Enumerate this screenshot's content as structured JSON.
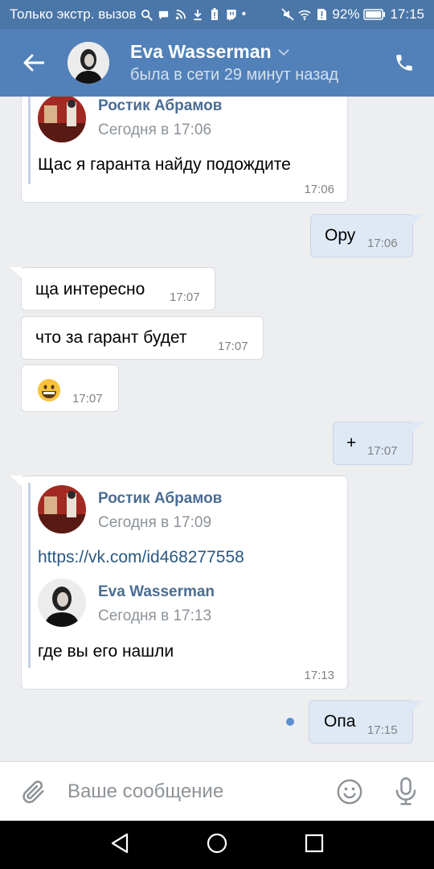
{
  "statusbar": {
    "carrier": "Только экстр. вызов",
    "battery": "92%",
    "time": "17:15"
  },
  "header": {
    "name": "Eva Wasserman",
    "status": "была в сети 29 минут назад"
  },
  "messages": [
    {
      "forward_name": "Ростик Абрамов",
      "forward_date": "Сегодня в 17:06",
      "text": "Щас я гаранта найду подождите",
      "time": "17:06"
    },
    {
      "text": "Ору",
      "time": "17:06"
    },
    {
      "text": "ща интересно",
      "time": "17:07"
    },
    {
      "text": "что за гарант будет",
      "time": "17:07"
    },
    {
      "emoji": "😄",
      "time": "17:07"
    },
    {
      "text": "+",
      "time": "17:07"
    },
    {
      "forward_name": "Ростик Абрамов",
      "forward_date": "Сегодня в 17:09",
      "link": "https://vk.com/id468277558",
      "nested_name": "Eva Wasserman",
      "nested_date": "Сегодня в 17:13",
      "text": "где вы его нашли",
      "time": "17:13"
    },
    {
      "text": "Опа",
      "time": "17:15"
    }
  ],
  "composer": {
    "placeholder": "Ваше сообщение"
  },
  "colors": {
    "header": "#5181b8",
    "statusbar": "#4a76a8",
    "background": "#edeef0",
    "outgoing_bubble": "#dfe9f5",
    "link": "#2a5885"
  },
  "icons": {
    "back": "arrow-left-icon",
    "call": "phone-icon",
    "attach": "paperclip-icon",
    "emoji": "smiley-icon",
    "mic": "microphone-icon",
    "nav": [
      "back-triangle-icon",
      "home-circle-icon",
      "recents-square-icon"
    ]
  }
}
